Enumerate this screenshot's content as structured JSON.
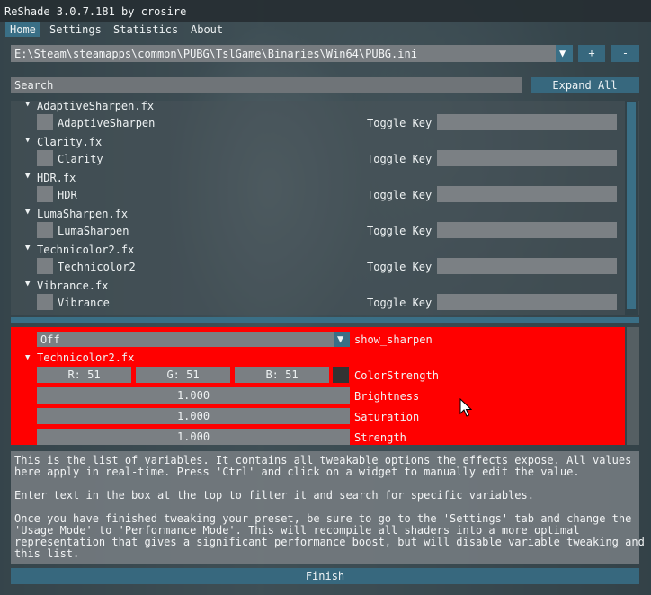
{
  "window": {
    "title": "ReShade 3.0.7.181 by crosire"
  },
  "menu": {
    "items": [
      {
        "label": "Home",
        "active": true
      },
      {
        "label": "Settings"
      },
      {
        "label": "Statistics"
      },
      {
        "label": "About"
      }
    ]
  },
  "preset": {
    "path": "E:\\Steam\\steamapps\\common\\PUBG\\TslGame\\Binaries\\Win64\\PUBG.ini",
    "add_label": "+",
    "remove_label": "-",
    "dropdown_icon": "triangle-down-icon"
  },
  "search": {
    "placeholder": "Search"
  },
  "expand_all_label": "Expand All",
  "effects": [
    {
      "file": "AdaptiveSharpen.fx",
      "technique": "AdaptiveSharpen",
      "enabled": false
    },
    {
      "file": "Clarity.fx",
      "technique": "Clarity",
      "enabled": false
    },
    {
      "file": "HDR.fx",
      "technique": "HDR",
      "enabled": false
    },
    {
      "file": "LumaSharpen.fx",
      "technique": "LumaSharpen",
      "enabled": false
    },
    {
      "file": "Technicolor2.fx",
      "technique": "Technicolor2",
      "enabled": false
    },
    {
      "file": "Vibrance.fx",
      "technique": "Vibrance",
      "enabled": false
    }
  ],
  "toggle_key_label": "Toggle Key",
  "variables": {
    "show_sharpen": {
      "value": "Off",
      "label": "show_sharpen"
    },
    "section": "Technicolor2.fx",
    "color_strength": {
      "r": "R: 51",
      "g": "G: 51",
      "b": "B: 51",
      "label": "ColorStrength",
      "swatch": "#333333"
    },
    "brightness": {
      "value": "1.000",
      "label": "Brightness"
    },
    "saturation": {
      "value": "1.000",
      "label": "Saturation"
    },
    "strength": {
      "value": "1.000",
      "label": "Strength"
    },
    "background": "#ff0000"
  },
  "help_text": "This is the list of variables. It contains all tweakable options the effects expose. All values\nhere apply in real-time. Press 'Ctrl' and click on a widget to manually edit the value.\n\nEnter text in the box at the top to filter it and search for specific variables.\n\nOnce you have finished tweaking your preset, be sure to go to the 'Settings' tab and change the\n'Usage Mode' to 'Performance Mode'. This will recompile all shaders into a more optimal\nrepresentation that gives a significant performance boost, but will disable variable tweaking and\nthis list.",
  "finish_label": "Finish",
  "colors": {
    "accent": "#3a6f86",
    "highlight": "#ff0000"
  }
}
